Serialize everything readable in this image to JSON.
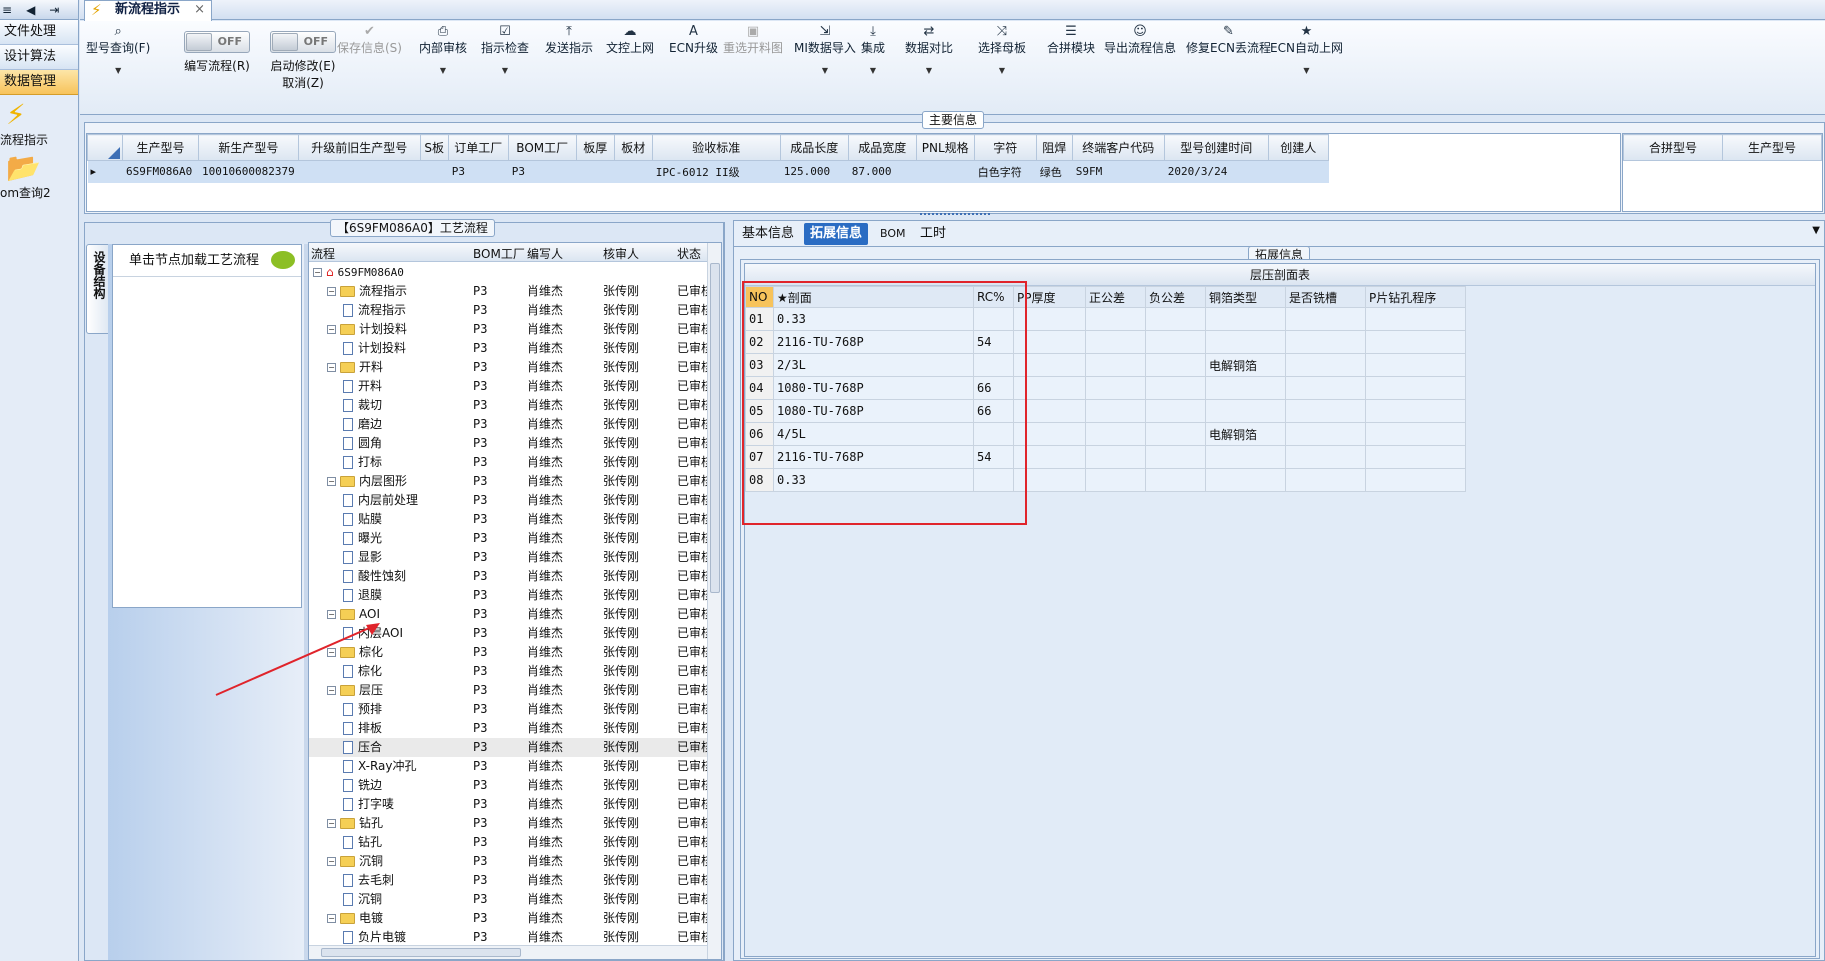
{
  "left_nav": {
    "items": [
      "文件处理",
      "设计算法",
      "数据管理"
    ],
    "active_index": 2,
    "tools": [
      {
        "label": "流程指示",
        "icon": "lightning-icon"
      },
      {
        "label": "om查询2",
        "icon": "folder-open-icon"
      }
    ]
  },
  "tab": {
    "title": "新流程指示",
    "close": "×"
  },
  "toolbar": {
    "buttons": [
      {
        "label": "型号查询(F)",
        "icon": "search-icon",
        "dropdown": true,
        "enabled": true
      },
      {
        "label": "保存信息(S)",
        "icon": "check-icon",
        "dropdown": false,
        "enabled": false
      },
      {
        "label": "内部审核",
        "icon": "printer-icon",
        "dropdown": true,
        "enabled": true
      },
      {
        "label": "指示检查",
        "icon": "checklist-icon",
        "dropdown": true,
        "enabled": true
      },
      {
        "label": "发送指示",
        "icon": "upload-icon",
        "dropdown": false,
        "enabled": true
      },
      {
        "label": "文控上网",
        "icon": "cloud-upload-icon",
        "dropdown": false,
        "enabled": true
      },
      {
        "label": "ECN升级",
        "icon": "font-icon",
        "dropdown": false,
        "enabled": true
      },
      {
        "label": "重选开料图",
        "icon": "image-icon",
        "dropdown": false,
        "enabled": false
      },
      {
        "label": "MI数据导入",
        "icon": "import-icon",
        "dropdown": true,
        "enabled": true
      },
      {
        "label": "集成",
        "icon": "download-icon",
        "dropdown": true,
        "enabled": true
      },
      {
        "label": "数据对比",
        "icon": "compare-icon",
        "dropdown": true,
        "enabled": true
      },
      {
        "label": "选择母板",
        "icon": "shuffle-icon",
        "dropdown": true,
        "enabled": true
      },
      {
        "label": "合拼模块",
        "icon": "list-icon",
        "dropdown": false,
        "enabled": true
      },
      {
        "label": "导出流程信息",
        "icon": "smiley-icon",
        "dropdown": false,
        "enabled": true
      },
      {
        "label": "修复ECN丢流程",
        "icon": "wrench-icon",
        "dropdown": false,
        "enabled": true
      },
      {
        "label": "ECN自动上网",
        "icon": "star-icon",
        "dropdown": true,
        "enabled": true
      }
    ],
    "toggles": [
      {
        "label": "编写流程(R)",
        "state": "OFF",
        "sub": ""
      },
      {
        "label": "启动修改(E)",
        "state": "OFF",
        "sub": "取消(Z)"
      }
    ]
  },
  "main_info": {
    "title": "主要信息",
    "columns": [
      "生产型号",
      "新生产型号",
      "升级前旧生产型号",
      "S板",
      "订单工厂",
      "BOM工厂",
      "板厚",
      "板材",
      "验收标准",
      "成品长度",
      "成品宽度",
      "PNL规格",
      "字符",
      "阻焊",
      "终端客户代码",
      "型号创建时间",
      "创建人"
    ],
    "row": [
      "6S9FM086A0",
      "10010600082379",
      "",
      "",
      "P3",
      "P3",
      "",
      "",
      "IPC-6012 II级",
      "125.000",
      "87.000",
      "",
      "白色字符",
      "绿色",
      "S9FM",
      "2020/3/24",
      ""
    ],
    "side_columns": [
      "合拼型号",
      "生产型号"
    ]
  },
  "flow_section": {
    "title": "【6S9FM086A0】工艺流程",
    "side_tab": "设备结构",
    "hint": "单击节点加载工艺流程"
  },
  "tree": {
    "columns": [
      "流程",
      "BOM工厂",
      "编写人",
      "核审人",
      "状态"
    ],
    "root": "6S9FM086A0",
    "rows": [
      {
        "name": "流程指示",
        "level": 1,
        "factory": "P3",
        "writer": "肖维杰",
        "auditor": "张传刚",
        "status": "已审核"
      },
      {
        "name": "流程指示",
        "level": 2,
        "factory": "P3",
        "writer": "肖维杰",
        "auditor": "张传刚",
        "status": "已审核"
      },
      {
        "name": "计划投料",
        "level": 1,
        "factory": "P3",
        "writer": "肖维杰",
        "auditor": "张传刚",
        "status": "已审核"
      },
      {
        "name": "计划投料",
        "level": 2,
        "factory": "P3",
        "writer": "肖维杰",
        "auditor": "张传刚",
        "status": "已审核"
      },
      {
        "name": "开料",
        "level": 1,
        "factory": "P3",
        "writer": "肖维杰",
        "auditor": "张传刚",
        "status": "已审核"
      },
      {
        "name": "开料",
        "level": 2,
        "factory": "P3",
        "writer": "肖维杰",
        "auditor": "张传刚",
        "status": "已审核"
      },
      {
        "name": "裁切",
        "level": 2,
        "factory": "P3",
        "writer": "肖维杰",
        "auditor": "张传刚",
        "status": "已审核"
      },
      {
        "name": "磨边",
        "level": 2,
        "factory": "P3",
        "writer": "肖维杰",
        "auditor": "张传刚",
        "status": "已审核"
      },
      {
        "name": "圆角",
        "level": 2,
        "factory": "P3",
        "writer": "肖维杰",
        "auditor": "张传刚",
        "status": "已审核"
      },
      {
        "name": "打标",
        "level": 2,
        "factory": "P3",
        "writer": "肖维杰",
        "auditor": "张传刚",
        "status": "已审核"
      },
      {
        "name": "内层图形",
        "level": 1,
        "factory": "P3",
        "writer": "肖维杰",
        "auditor": "张传刚",
        "status": "已审核"
      },
      {
        "name": "内层前处理",
        "level": 2,
        "factory": "P3",
        "writer": "肖维杰",
        "auditor": "张传刚",
        "status": "已审核"
      },
      {
        "name": "贴膜",
        "level": 2,
        "factory": "P3",
        "writer": "肖维杰",
        "auditor": "张传刚",
        "status": "已审核"
      },
      {
        "name": "曝光",
        "level": 2,
        "factory": "P3",
        "writer": "肖维杰",
        "auditor": "张传刚",
        "status": "已审核"
      },
      {
        "name": "显影",
        "level": 2,
        "factory": "P3",
        "writer": "肖维杰",
        "auditor": "张传刚",
        "status": "已审核"
      },
      {
        "name": "酸性蚀刻",
        "level": 2,
        "factory": "P3",
        "writer": "肖维杰",
        "auditor": "张传刚",
        "status": "已审核"
      },
      {
        "name": "退膜",
        "level": 2,
        "factory": "P3",
        "writer": "肖维杰",
        "auditor": "张传刚",
        "status": "已审核"
      },
      {
        "name": "AOI",
        "level": 1,
        "factory": "P3",
        "writer": "肖维杰",
        "auditor": "张传刚",
        "status": "已审核"
      },
      {
        "name": "内层AOI",
        "level": 2,
        "factory": "P3",
        "writer": "肖维杰",
        "auditor": "张传刚",
        "status": "已审核"
      },
      {
        "name": "棕化",
        "level": 1,
        "factory": "P3",
        "writer": "肖维杰",
        "auditor": "张传刚",
        "status": "已审核"
      },
      {
        "name": "棕化",
        "level": 2,
        "factory": "P3",
        "writer": "肖维杰",
        "auditor": "张传刚",
        "status": "已审核"
      },
      {
        "name": "层压",
        "level": 1,
        "factory": "P3",
        "writer": "肖维杰",
        "auditor": "张传刚",
        "status": "已审核"
      },
      {
        "name": "预排",
        "level": 2,
        "factory": "P3",
        "writer": "肖维杰",
        "auditor": "张传刚",
        "status": "已审核"
      },
      {
        "name": "排板",
        "level": 2,
        "factory": "P3",
        "writer": "肖维杰",
        "auditor": "张传刚",
        "status": "已审核"
      },
      {
        "name": "压合",
        "level": 2,
        "factory": "P3",
        "writer": "肖维杰",
        "auditor": "张传刚",
        "status": "已审核",
        "selected": true
      },
      {
        "name": "X-Ray冲孔",
        "level": 2,
        "factory": "P3",
        "writer": "肖维杰",
        "auditor": "张传刚",
        "status": "已审核"
      },
      {
        "name": "铣边",
        "level": 2,
        "factory": "P3",
        "writer": "肖维杰",
        "auditor": "张传刚",
        "status": "已审核"
      },
      {
        "name": "打字唛",
        "level": 2,
        "factory": "P3",
        "writer": "肖维杰",
        "auditor": "张传刚",
        "status": "已审核"
      },
      {
        "name": "钻孔",
        "level": 1,
        "factory": "P3",
        "writer": "肖维杰",
        "auditor": "张传刚",
        "status": "已审核"
      },
      {
        "name": "钻孔",
        "level": 2,
        "factory": "P3",
        "writer": "肖维杰",
        "auditor": "张传刚",
        "status": "已审核"
      },
      {
        "name": "沉铜",
        "level": 1,
        "factory": "P3",
        "writer": "肖维杰",
        "auditor": "张传刚",
        "status": "已审核"
      },
      {
        "name": "去毛刺",
        "level": 2,
        "factory": "P3",
        "writer": "肖维杰",
        "auditor": "张传刚",
        "status": "已审核"
      },
      {
        "name": "沉铜",
        "level": 2,
        "factory": "P3",
        "writer": "肖维杰",
        "auditor": "张传刚",
        "status": "已审核"
      },
      {
        "name": "电镀",
        "level": 1,
        "factory": "P3",
        "writer": "肖维杰",
        "auditor": "张传刚",
        "status": "已审核"
      },
      {
        "name": "负片电镀",
        "level": 2,
        "factory": "P3",
        "writer": "肖维杰",
        "auditor": "张传刚",
        "status": "已审核"
      }
    ]
  },
  "right_tabs": {
    "items": [
      "基本信息",
      "拓展信息",
      "BOM",
      "工时"
    ],
    "active_index": 1
  },
  "ext_info": {
    "title": "拓展信息",
    "table_title": "层压剖面表",
    "columns": [
      "NO",
      "★剖面",
      "RC%",
      "PP厚度",
      "正公差",
      "负公差",
      "铜箔类型",
      "是否铣槽",
      "P片钻孔程序"
    ],
    "rows": [
      [
        "01",
        "0.33",
        "",
        "",
        "",
        "",
        "",
        "",
        ""
      ],
      [
        "02",
        "2116-TU-768P",
        "54",
        "",
        "",
        "",
        "",
        "",
        ""
      ],
      [
        "03",
        "2/3L",
        "",
        "",
        "",
        "",
        "电解铜箔",
        "",
        ""
      ],
      [
        "04",
        "1080-TU-768P",
        "66",
        "",
        "",
        "",
        "",
        "",
        ""
      ],
      [
        "05",
        "1080-TU-768P",
        "66",
        "",
        "",
        "",
        "",
        "",
        ""
      ],
      [
        "06",
        "4/5L",
        "",
        "",
        "",
        "",
        "电解铜箔",
        "",
        ""
      ],
      [
        "07",
        "2116-TU-768P",
        "54",
        "",
        "",
        "",
        "",
        "",
        ""
      ],
      [
        "08",
        "0.33",
        "",
        "",
        "",
        "",
        "",
        "",
        ""
      ]
    ]
  },
  "colors": {
    "accent": "#2a6cc3",
    "highlight_box": "#e0242b",
    "arrow": "#e0242b",
    "row_select": "#cfe0f4"
  }
}
